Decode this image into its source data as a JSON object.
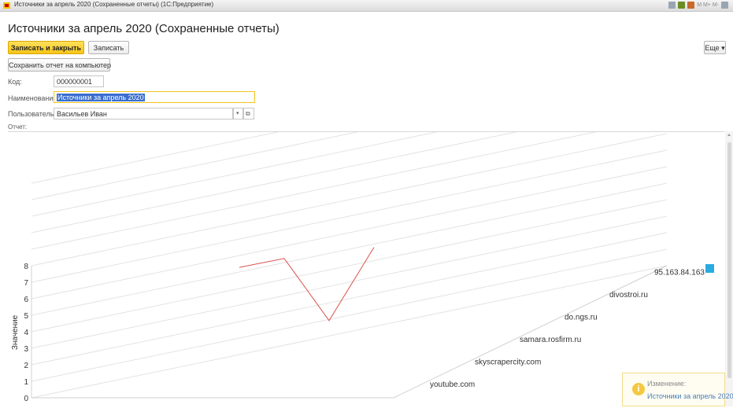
{
  "window": {
    "title": "Источники за апрель 2020 (Сохраненные отчеты) (1С:Предприятие)",
    "controls_text": "M M+ M-"
  },
  "form": {
    "title": "Источники за апрель 2020 (Сохраненные отчеты)"
  },
  "toolbar": {
    "save_close_label": "Записать и закрыть",
    "save_label": "Записать",
    "more_label": "Еще ▾",
    "save_to_pc_label": "Сохранить отчет на компьютер"
  },
  "fields": {
    "code_label": "Код:",
    "code_value": "000000001",
    "name_label": "Наименование:",
    "name_value": "Источники за апрель 2020",
    "user_label": "Пользователь:",
    "user_value": "Васильев Иван",
    "report_label": "Отчет:"
  },
  "notification": {
    "title": "Изменение:",
    "link": "Источники за апрель 2020"
  },
  "colors": {
    "accent": "#f5c518",
    "series_line": "#d9534f",
    "legend_marker": "#29abe2",
    "selection": "#3a6ecf"
  },
  "chart_data": {
    "type": "line",
    "view": "3d",
    "ylabel": "Значение",
    "yticks": [
      "0",
      "1",
      "2",
      "3",
      "4",
      "5",
      "6",
      "7",
      "8"
    ],
    "categories": [
      "youtube.com",
      "skyscrapercity.com",
      "samara.rosfirm.ru",
      "do.ngs.ru",
      "divostroi.ru",
      "95.163.84.163"
    ],
    "ylim": [
      0,
      8
    ],
    "grid": true,
    "legend": "right",
    "series": [
      {
        "values": [
          7.9,
          8.2,
          4.2,
          8.4
        ]
      }
    ]
  }
}
